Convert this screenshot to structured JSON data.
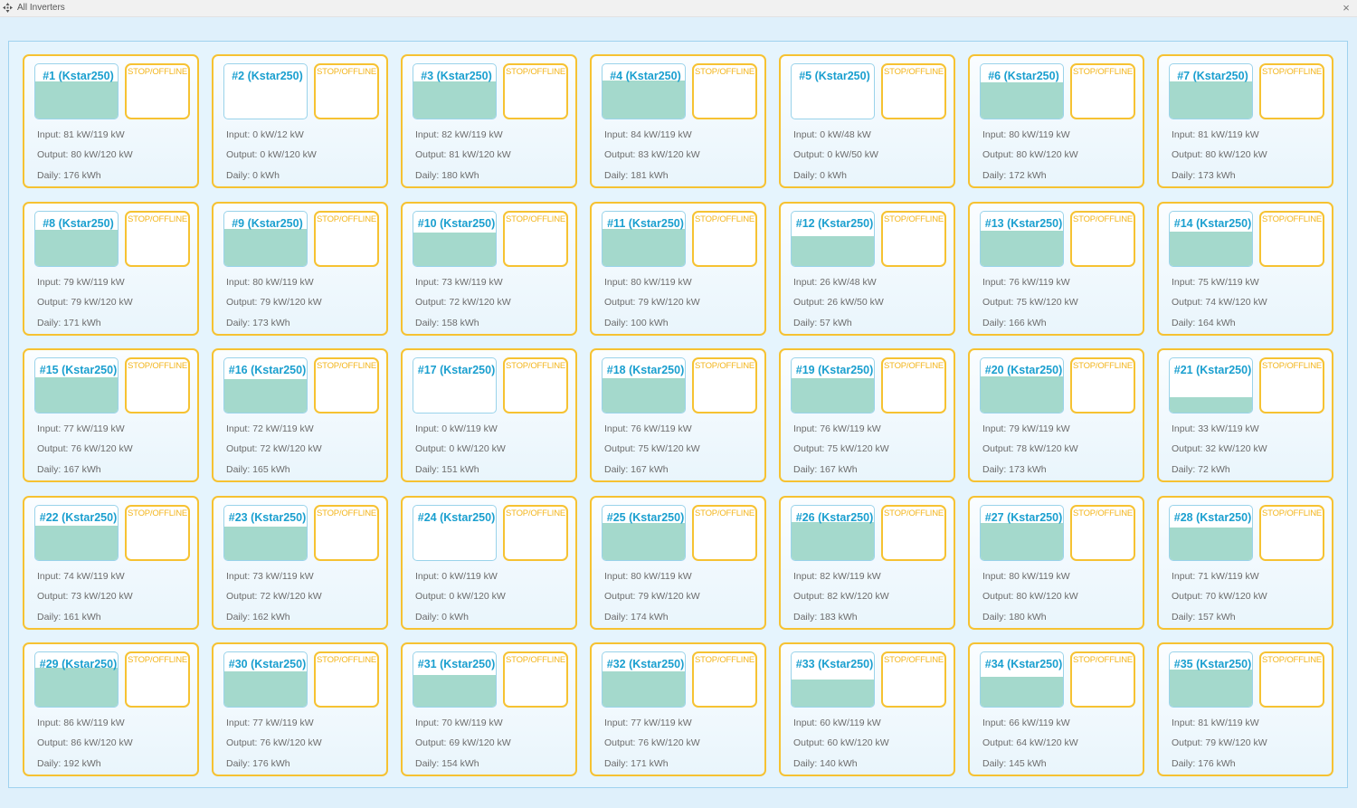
{
  "window": {
    "title": "All Inverters",
    "close_label": "×"
  },
  "colors": {
    "accent": "#1a9fcf",
    "status": "#f3b51c",
    "border": "#f6c232",
    "fill": "#a4d9cc"
  },
  "inverters": [
    {
      "name": "#1 (Kstar250)",
      "status": "STOP/OFFLINE",
      "load": 0.68,
      "input": "Input: 81 kW/119 kW",
      "output": "Output: 80 kW/120 kW",
      "daily": "Daily: 176 kWh"
    },
    {
      "name": "#2 (Kstar250)",
      "status": "STOP/OFFLINE",
      "load": 0.0,
      "input": "Input: 0 kW/12 kW",
      "output": "Output: 0 kW/120 kW",
      "daily": "Daily: 0 kWh"
    },
    {
      "name": "#3 (Kstar250)",
      "status": "STOP/OFFLINE",
      "load": 0.68,
      "input": "Input: 82 kW/119 kW",
      "output": "Output: 81 kW/120 kW",
      "daily": "Daily: 180 kWh"
    },
    {
      "name": "#4 (Kstar250)",
      "status": "STOP/OFFLINE",
      "load": 0.7,
      "input": "Input: 84 kW/119 kW",
      "output": "Output: 83 kW/120 kW",
      "daily": "Daily: 181 kWh"
    },
    {
      "name": "#5 (Kstar250)",
      "status": "STOP/OFFLINE",
      "load": 0.0,
      "input": "Input: 0 kW/48 kW",
      "output": "Output: 0 kW/50 kW",
      "daily": "Daily: 0 kWh"
    },
    {
      "name": "#6 (Kstar250)",
      "status": "STOP/OFFLINE",
      "load": 0.67,
      "input": "Input: 80 kW/119 kW",
      "output": "Output: 80 kW/120 kW",
      "daily": "Daily: 172 kWh"
    },
    {
      "name": "#7 (Kstar250)",
      "status": "STOP/OFFLINE",
      "load": 0.68,
      "input": "Input: 81 kW/119 kW",
      "output": "Output: 80 kW/120 kW",
      "daily": "Daily: 173 kWh"
    },
    {
      "name": "#8 (Kstar250)",
      "status": "STOP/OFFLINE",
      "load": 0.66,
      "input": "Input: 79 kW/119 kW",
      "output": "Output: 79 kW/120 kW",
      "daily": "Daily: 171 kWh"
    },
    {
      "name": "#9 (Kstar250)",
      "status": "STOP/OFFLINE",
      "load": 0.67,
      "input": "Input: 80 kW/119 kW",
      "output": "Output: 79 kW/120 kW",
      "daily": "Daily: 173 kWh"
    },
    {
      "name": "#10 (Kstar250)",
      "status": "STOP/OFFLINE",
      "load": 0.61,
      "input": "Input: 73 kW/119 kW",
      "output": "Output: 72 kW/120 kW",
      "daily": "Daily: 158 kWh"
    },
    {
      "name": "#11 (Kstar250)",
      "status": "STOP/OFFLINE",
      "load": 0.67,
      "input": "Input: 80 kW/119 kW",
      "output": "Output: 79 kW/120 kW",
      "daily": "Daily: 100 kWh"
    },
    {
      "name": "#12 (Kstar250)",
      "status": "STOP/OFFLINE",
      "load": 0.54,
      "input": "Input: 26 kW/48 kW",
      "output": "Output: 26 kW/50 kW",
      "daily": "Daily: 57 kWh"
    },
    {
      "name": "#13 (Kstar250)",
      "status": "STOP/OFFLINE",
      "load": 0.64,
      "input": "Input: 76 kW/119 kW",
      "output": "Output: 75 kW/120 kW",
      "daily": "Daily: 166 kWh"
    },
    {
      "name": "#14 (Kstar250)",
      "status": "STOP/OFFLINE",
      "load": 0.63,
      "input": "Input: 75 kW/119 kW",
      "output": "Output: 74 kW/120 kW",
      "daily": "Daily: 164 kWh"
    },
    {
      "name": "#15 (Kstar250)",
      "status": "STOP/OFFLINE",
      "load": 0.65,
      "input": "Input: 77 kW/119 kW",
      "output": "Output: 76 kW/120 kW",
      "daily": "Daily: 167 kWh"
    },
    {
      "name": "#16 (Kstar250)",
      "status": "STOP/OFFLINE",
      "load": 0.61,
      "input": "Input: 72 kW/119 kW",
      "output": "Output: 72 kW/120 kW",
      "daily": "Daily: 165 kWh"
    },
    {
      "name": "#17 (Kstar250)",
      "status": "STOP/OFFLINE",
      "load": 0.0,
      "input": "Input: 0 kW/119 kW",
      "output": "Output: 0 kW/120 kW",
      "daily": "Daily: 151 kWh"
    },
    {
      "name": "#18 (Kstar250)",
      "status": "STOP/OFFLINE",
      "load": 0.64,
      "input": "Input: 76 kW/119 kW",
      "output": "Output: 75 kW/120 kW",
      "daily": "Daily: 167 kWh"
    },
    {
      "name": "#19 (Kstar250)",
      "status": "STOP/OFFLINE",
      "load": 0.64,
      "input": "Input: 76 kW/119 kW",
      "output": "Output: 75 kW/120 kW",
      "daily": "Daily: 167 kWh"
    },
    {
      "name": "#20 (Kstar250)",
      "status": "STOP/OFFLINE",
      "load": 0.66,
      "input": "Input: 79 kW/119 kW",
      "output": "Output: 78 kW/120 kW",
      "daily": "Daily: 173 kWh"
    },
    {
      "name": "#21 (Kstar250)",
      "status": "STOP/OFFLINE",
      "load": 0.28,
      "input": "Input: 33 kW/119 kW",
      "output": "Output: 32 kW/120 kW",
      "daily": "Daily: 72 kWh"
    },
    {
      "name": "#22 (Kstar250)",
      "status": "STOP/OFFLINE",
      "load": 0.62,
      "input": "Input: 74 kW/119 kW",
      "output": "Output: 73 kW/120 kW",
      "daily": "Daily: 161 kWh"
    },
    {
      "name": "#23 (Kstar250)",
      "status": "STOP/OFFLINE",
      "load": 0.61,
      "input": "Input: 73 kW/119 kW",
      "output": "Output: 72 kW/120 kW",
      "daily": "Daily: 162 kWh"
    },
    {
      "name": "#24 (Kstar250)",
      "status": "STOP/OFFLINE",
      "load": 0.0,
      "input": "Input: 0 kW/119 kW",
      "output": "Output: 0 kW/120 kW",
      "daily": "Daily: 0 kWh"
    },
    {
      "name": "#25 (Kstar250)",
      "status": "STOP/OFFLINE",
      "load": 0.67,
      "input": "Input: 80 kW/119 kW",
      "output": "Output: 79 kW/120 kW",
      "daily": "Daily: 174 kWh"
    },
    {
      "name": "#26 (Kstar250)",
      "status": "STOP/OFFLINE",
      "load": 0.69,
      "input": "Input: 82 kW/119 kW",
      "output": "Output: 82 kW/120 kW",
      "daily": "Daily: 183 kWh"
    },
    {
      "name": "#27 (Kstar250)",
      "status": "STOP/OFFLINE",
      "load": 0.67,
      "input": "Input: 80 kW/119 kW",
      "output": "Output: 80 kW/120 kW",
      "daily": "Daily: 180 kWh"
    },
    {
      "name": "#28 (Kstar250)",
      "status": "STOP/OFFLINE",
      "load": 0.6,
      "input": "Input: 71 kW/119 kW",
      "output": "Output: 70 kW/120 kW",
      "daily": "Daily: 157 kWh"
    },
    {
      "name": "#29 (Kstar250)",
      "status": "STOP/OFFLINE",
      "load": 0.72,
      "input": "Input: 86 kW/119 kW",
      "output": "Output: 86 kW/120 kW",
      "daily": "Daily: 192 kWh"
    },
    {
      "name": "#30 (Kstar250)",
      "status": "STOP/OFFLINE",
      "load": 0.65,
      "input": "Input: 77 kW/119 kW",
      "output": "Output: 76 kW/120 kW",
      "daily": "Daily: 176 kWh"
    },
    {
      "name": "#31 (Kstar250)",
      "status": "STOP/OFFLINE",
      "load": 0.59,
      "input": "Input: 70 kW/119 kW",
      "output": "Output: 69 kW/120 kW",
      "daily": "Daily: 154 kWh"
    },
    {
      "name": "#32 (Kstar250)",
      "status": "STOP/OFFLINE",
      "load": 0.65,
      "input": "Input: 77 kW/119 kW",
      "output": "Output: 76 kW/120 kW",
      "daily": "Daily: 171 kWh"
    },
    {
      "name": "#33 (Kstar250)",
      "status": "STOP/OFFLINE",
      "load": 0.5,
      "input": "Input: 60 kW/119 kW",
      "output": "Output: 60 kW/120 kW",
      "daily": "Daily: 140 kWh"
    },
    {
      "name": "#34 (Kstar250)",
      "status": "STOP/OFFLINE",
      "load": 0.55,
      "input": "Input: 66 kW/119 kW",
      "output": "Output: 64 kW/120 kW",
      "daily": "Daily: 145 kWh"
    },
    {
      "name": "#35 (Kstar250)",
      "status": "STOP/OFFLINE",
      "load": 0.68,
      "input": "Input: 81 kW/119 kW",
      "output": "Output: 79 kW/120 kW",
      "daily": "Daily: 176 kWh"
    }
  ]
}
